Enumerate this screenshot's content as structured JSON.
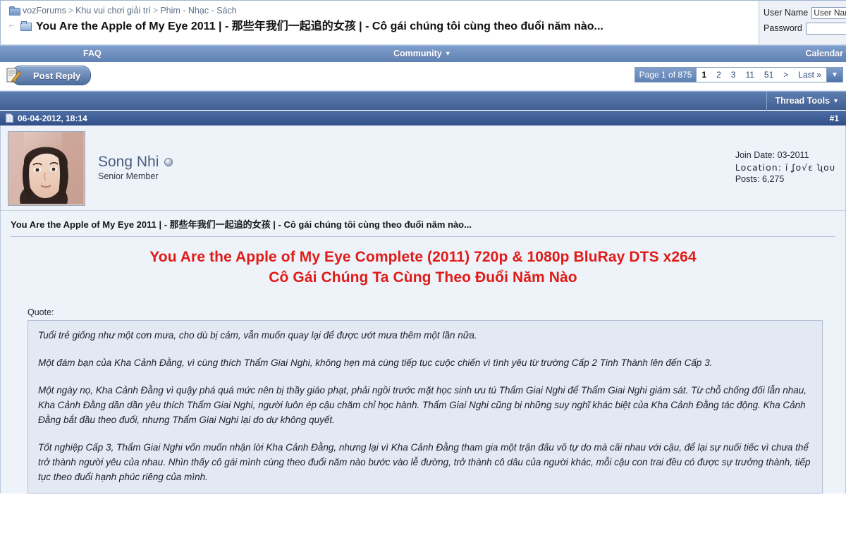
{
  "breadcrumb": {
    "icon": "folder-icon",
    "items": [
      "vozForums",
      "Khu vui chơi giải trí",
      "Phim - Nhạc - Sách"
    ],
    "separator": ">",
    "thread_icon": "thread-icon",
    "thread_title": "You Are the Apple of My Eye 2011 | - 那些年我们一起追的女孩 | - Cô gái chúng tôi cùng theo đuổi năm nào..."
  },
  "login": {
    "username_label": "User Name",
    "username_value": "User Name",
    "password_label": "Password",
    "password_value": ""
  },
  "navbar": {
    "faq": "FAQ",
    "community": "Community",
    "community_caret": "▼",
    "calendar": "Calendar"
  },
  "toolbar": {
    "post_reply_label": "Post Reply",
    "post_reply_icon": "compose-icon"
  },
  "pagination": {
    "page_count_label": "Page 1 of 875",
    "pages": [
      "1",
      "2",
      "3",
      "11",
      "51"
    ],
    "current_page": "1",
    "next_label": ">",
    "last_label": "Last »",
    "dropdown_icon": "▼"
  },
  "thread_tools": {
    "label": "Thread Tools",
    "caret": "▼"
  },
  "post": {
    "date": "06-04-2012, 18:14",
    "date_icon": "document-icon",
    "number": "#1",
    "author": {
      "name": "Song Nhi",
      "status_icon": "offline-status-icon",
      "title": "Senior Member",
      "avatar_alt": "user-avatar"
    },
    "stats": {
      "join_date": "Join Date: 03-2011",
      "location": "Location: ỉ ʆᴏ√ɛ ʯᴏᴜ",
      "posts": "Posts: 6,275"
    },
    "title": "You Are the Apple of My Eye 2011 | - 那些年我们一起追的女孩 | - Cô gái chúng tôi cùng theo đuổi năm nào...",
    "heading_line1": "You Are the Apple of My Eye Complete (2011) 720p & 1080p BluRay DTS x264",
    "heading_line2": "Cô Gái Chúng Ta Cùng Theo Đuổi Năm Nào",
    "heading_color": "#e01b17",
    "quote_label": "Quote:",
    "quote_paragraphs": [
      "Tuổi trẻ giống như một cơn mưa, cho dù bị cảm, vẫn muốn quay lại để được ướt mưa thêm một lần nữa.",
      "Một đám bạn của Kha Cảnh Đằng, vì cùng thích Thẩm Giai Nghi, không hẹn mà cùng tiếp tục cuộc chiến vì tình yêu từ trường Cấp 2 Tinh Thành lên đến Cấp 3.",
      "Một ngày nọ, Kha Cảnh Đằng vì quậy phá quá mức nên bị thầy giáo phạt, phải ngồi trước mặt học sinh ưu tú Thẩm Giai Nghi để Thẩm Giai Nghi giám sát. Từ chỗ chống đối lẫn nhau, Kha Cảnh Đằng dần dần yêu thích Thẩm Giai Nghi, người luôn ép cậu chăm chỉ học hành. Thẩm Giai Nghi cũng bị những suy nghĩ khác biệt của Kha Cảnh Đằng tác động. Kha Cảnh Đằng bắt đầu theo đuổi, nhưng Thẩm Giai Nghi lại do dự không quyết.",
      "Tốt nghiệp Cấp 3, Thẩm Giai Nghi vốn muốn nhận lời Kha Cảnh Đằng, nhưng lại vì Kha Cảnh Đằng tham gia một trận đấu võ tự do mà cãi nhau với cậu, để lại sự nuối tiếc vì chưa thể trở thành người yêu của nhau.\nNhìn thấy cô gái mình cùng theo đuổi năm nào bước vào lễ đường, trở thành cô dâu của người khác, mỗi cậu con trai đều có được sự trưởng thành, tiếp tục theo đuổi hạnh phúc riêng của mình."
    ]
  }
}
